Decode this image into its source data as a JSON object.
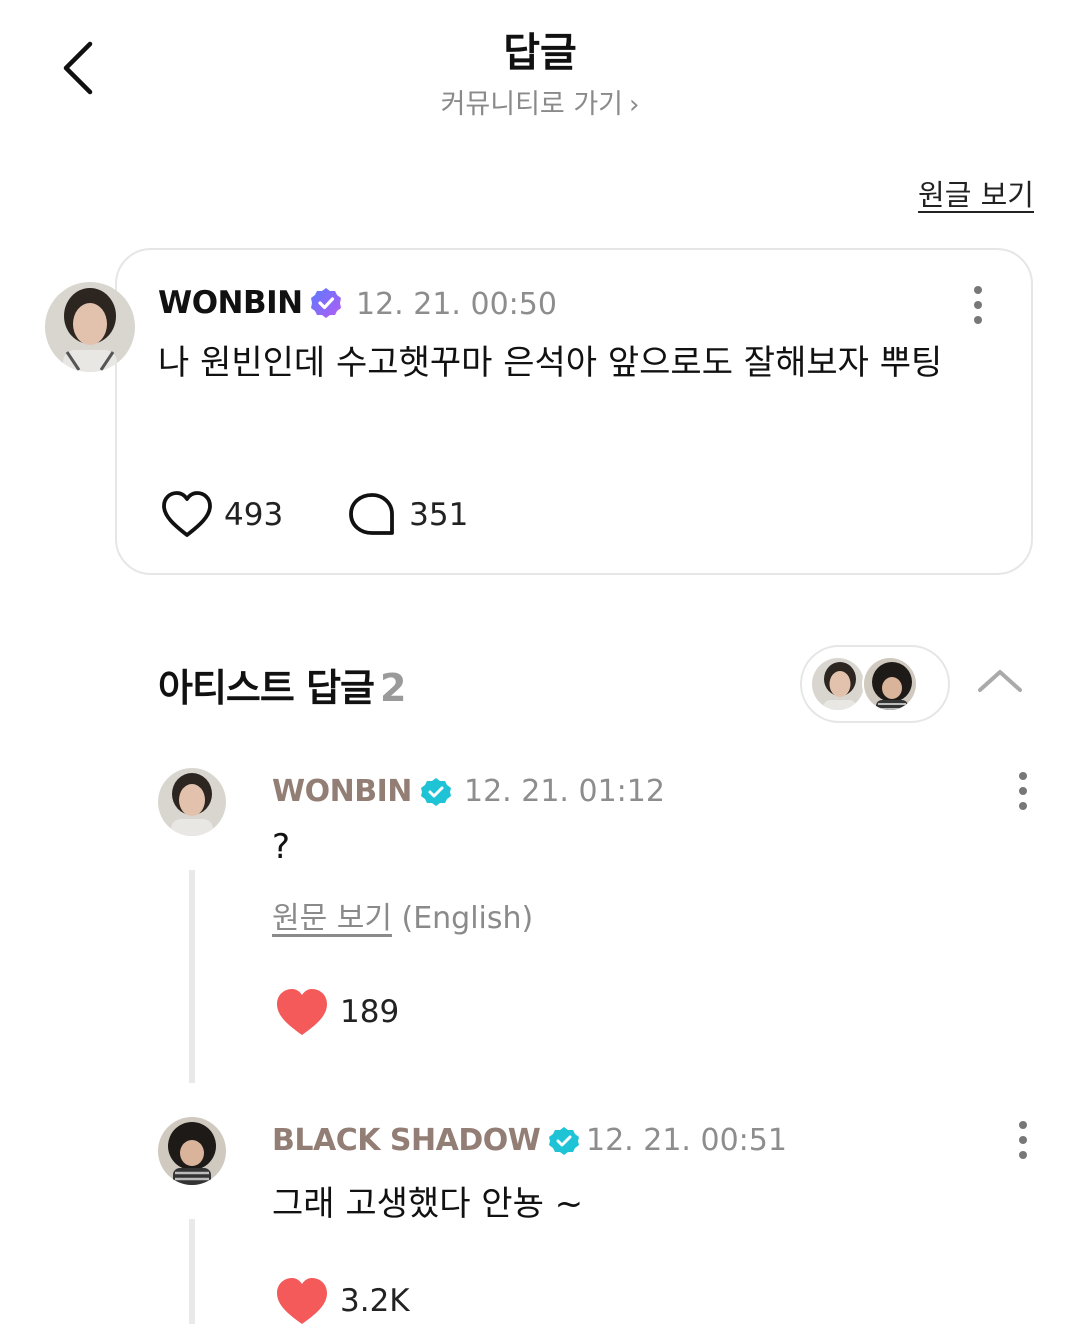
{
  "header": {
    "title": "답글",
    "community_link": "커뮤니티로 가기",
    "view_original": "원글 보기"
  },
  "post": {
    "author": "WONBIN",
    "timestamp": "12. 21. 00:50",
    "text": "나 원빈인데 수고햇꾸마 은석아 앞으로도 잘해보자 뿌팅",
    "likes": "493",
    "comments": "351"
  },
  "artist_replies": {
    "title": "아티스트 답글",
    "count": "2",
    "items": [
      {
        "author": "WONBIN",
        "timestamp": "12. 21. 01:12",
        "text": "?",
        "translate_link": "원문 보기",
        "translate_lang": "(English)",
        "likes": "189"
      },
      {
        "author": "BLACK SHADOW",
        "timestamp": "12. 21. 00:51",
        "text": "그래 고생했다 안뇽 ~",
        "likes": "3.2K"
      }
    ]
  },
  "colors": {
    "artist_name": "#937e76",
    "verified_badge": "#1ec3d6",
    "like_red": "#f45a5a",
    "meta_gray": "#8d8d8d"
  }
}
